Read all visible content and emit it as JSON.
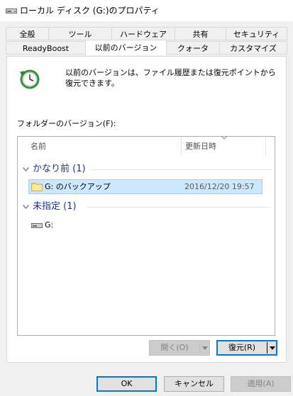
{
  "window": {
    "title": "ローカル ディスク (G:)のプロパティ",
    "icon": "drive-icon"
  },
  "tabs": {
    "row1": [
      {
        "label": "全般"
      },
      {
        "label": "ツール"
      },
      {
        "label": "ハードウェア"
      },
      {
        "label": "共有"
      },
      {
        "label": "セキュリティ"
      }
    ],
    "row2": [
      {
        "label": "ReadyBoost"
      },
      {
        "label": "以前のバージョン",
        "active": true
      },
      {
        "label": "クォータ"
      },
      {
        "label": "カスタマイズ"
      }
    ]
  },
  "description": {
    "icon": "restore-clock-icon",
    "text": "以前のバージョンは、ファイル履歴または復元ポイントから復元できます。"
  },
  "versions": {
    "label": "フォルダーのバージョン(F):",
    "columns": {
      "name": "名前",
      "modified": "更新日時"
    },
    "groups": [
      {
        "title": "かなり前 (1)",
        "items": [
          {
            "icon": "folder-icon",
            "name": "G: のバックアップ",
            "modified": "2016/12/20 19:57",
            "selected": true
          }
        ]
      },
      {
        "title": "未指定 (1)",
        "items": [
          {
            "icon": "drive-icon",
            "name": "G:",
            "modified": ""
          }
        ]
      }
    ]
  },
  "actions": {
    "open_label": "開く(O)",
    "restore_label": "復元(R)"
  },
  "dialog_buttons": {
    "ok": "OK",
    "cancel": "キャンセル",
    "apply": "適用(A)"
  },
  "colors": {
    "selection_bg": "#cce8ff",
    "selection_border": "#99d1ff",
    "group_header": "#1e3287",
    "accent": "#0078d7"
  }
}
